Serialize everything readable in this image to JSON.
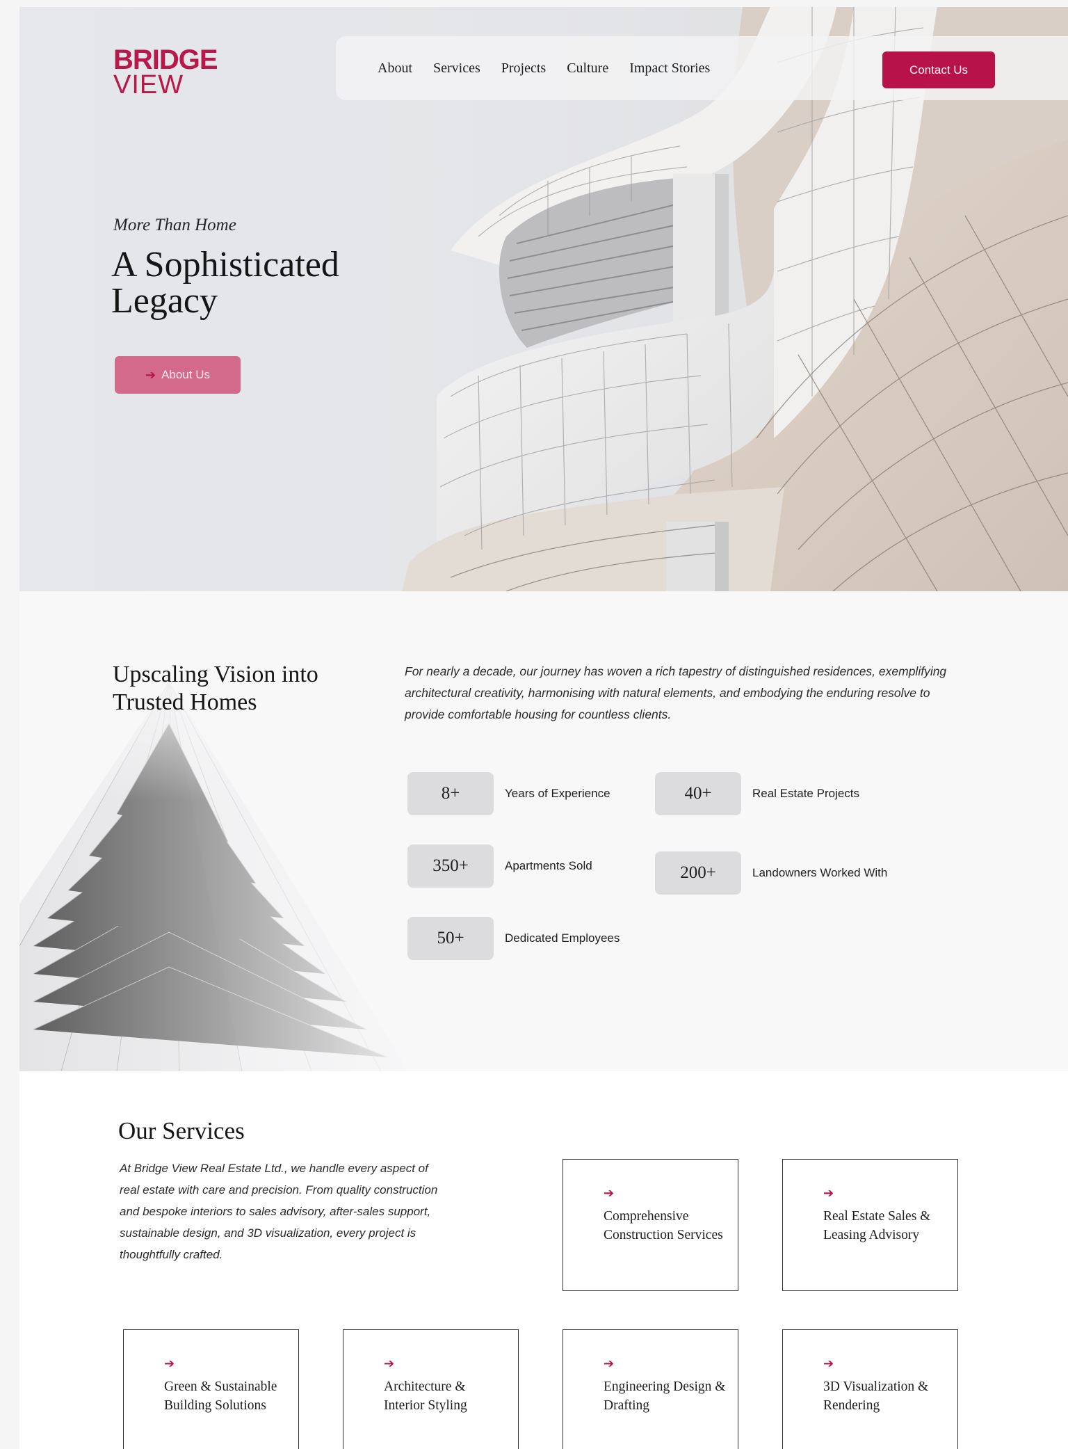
{
  "brand": {
    "logo_top": "BRIDGE",
    "logo_bottom": "VIEW",
    "accent_color": "#b8124a"
  },
  "nav": {
    "links": [
      {
        "label": "About"
      },
      {
        "label": "Services"
      },
      {
        "label": "Projects"
      },
      {
        "label": "Culture"
      },
      {
        "label": "Impact Stories"
      }
    ],
    "contact_label": "Contact Us"
  },
  "hero": {
    "eyebrow": "More Than Home",
    "title": "A Sophisticated Legacy",
    "button_label": "About Us",
    "button_icon": "arrow-right-icon"
  },
  "about": {
    "title": "Upscaling Vision into Trusted Homes",
    "text": "For nearly a decade, our journey has woven a rich tapestry of distinguished residences, exemplifying architectural creativity, harmonising with natural elements, and embodying the enduring resolve to provide comfortable housing for countless clients.",
    "stats": [
      {
        "value": "8+",
        "label": "Years of Experience"
      },
      {
        "value": "40+",
        "label": "Real Estate Projects"
      },
      {
        "value": "350+",
        "label": "Apartments Sold"
      },
      {
        "value": "200+",
        "label": "Landowners Worked With"
      },
      {
        "value": "50+",
        "label": "Dedicated Employees"
      }
    ]
  },
  "services": {
    "title": "Our Services",
    "text": "At Bridge View Real Estate Ltd., we handle every aspect of real estate with care and precision. From quality construction and bespoke interiors to sales advisory, after-sales support, sustainable design, and 3D visualization, every project is thoughtfully crafted.",
    "cards": [
      {
        "label": "Comprehensive Construction Services"
      },
      {
        "label": "Real Estate Sales & Leasing Advisory"
      },
      {
        "label": "Green & Sustainable Building Solutions"
      },
      {
        "label": "Architecture & Interior Styling"
      },
      {
        "label": "Engineering Design & Drafting"
      },
      {
        "label": "3D Visualization & Rendering"
      }
    ],
    "card_icon": "arrow-right-icon"
  }
}
